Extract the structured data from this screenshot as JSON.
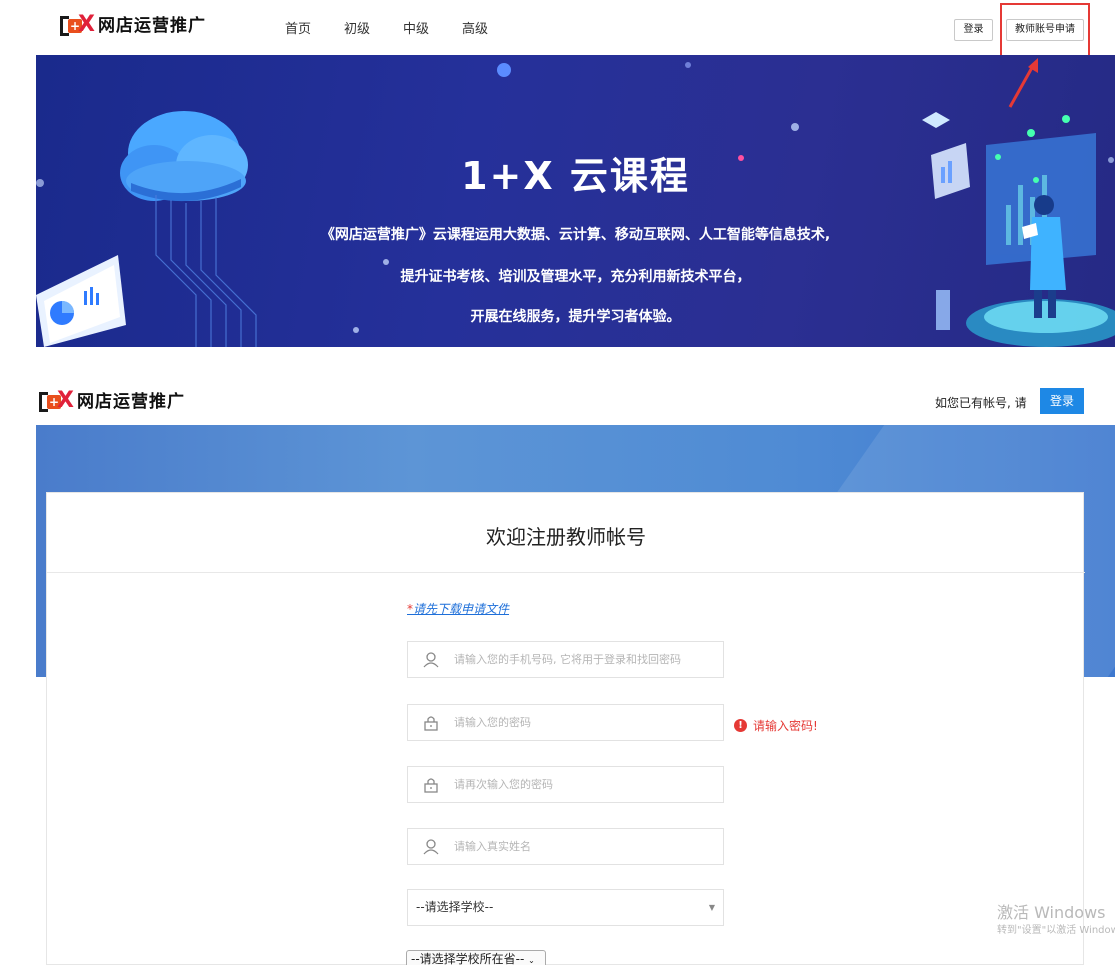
{
  "site_header": {
    "brand": "网店运营推广",
    "nav": [
      "首页",
      "初级",
      "中级",
      "高级"
    ],
    "login_label": "登录",
    "apply_label": "教师账号申请"
  },
  "banner": {
    "title": "1+X 云课程",
    "lines": [
      "《网店运营推广》云课程运用大数据、云计算、移动互联网、人工智能等信息技术,",
      "提升证书考核、培训及管理水平，充分利用新技术平台，",
      "开展在线服务，提升学习者体验。"
    ]
  },
  "register": {
    "brand": "网店运营推广",
    "hint": "如您已有帐号, 请",
    "login_label": "登录",
    "title": "欢迎注册教师帐号",
    "download_star": "*",
    "download_link": "请先下载申请文件",
    "fields": {
      "phone_placeholder": "请输入您的手机号码, 它将用于登录和找回密码",
      "password_placeholder": "请输入您的密码",
      "password_confirm_placeholder": "请再次输入您的密码",
      "realname_placeholder": "请输入真实姓名"
    },
    "password_error": "请输入密码!",
    "school_select": "--请选择学校--",
    "province_select": "--请选择学校所在省--"
  },
  "watermark": {
    "line1": "激活 Windows",
    "line2": "转到\"设置\"以激活 Windows。"
  },
  "colors": {
    "banner": "#25309a",
    "accent_blue": "#1e88e5",
    "error_red": "#e53935",
    "brand_red": "#e0213a"
  }
}
